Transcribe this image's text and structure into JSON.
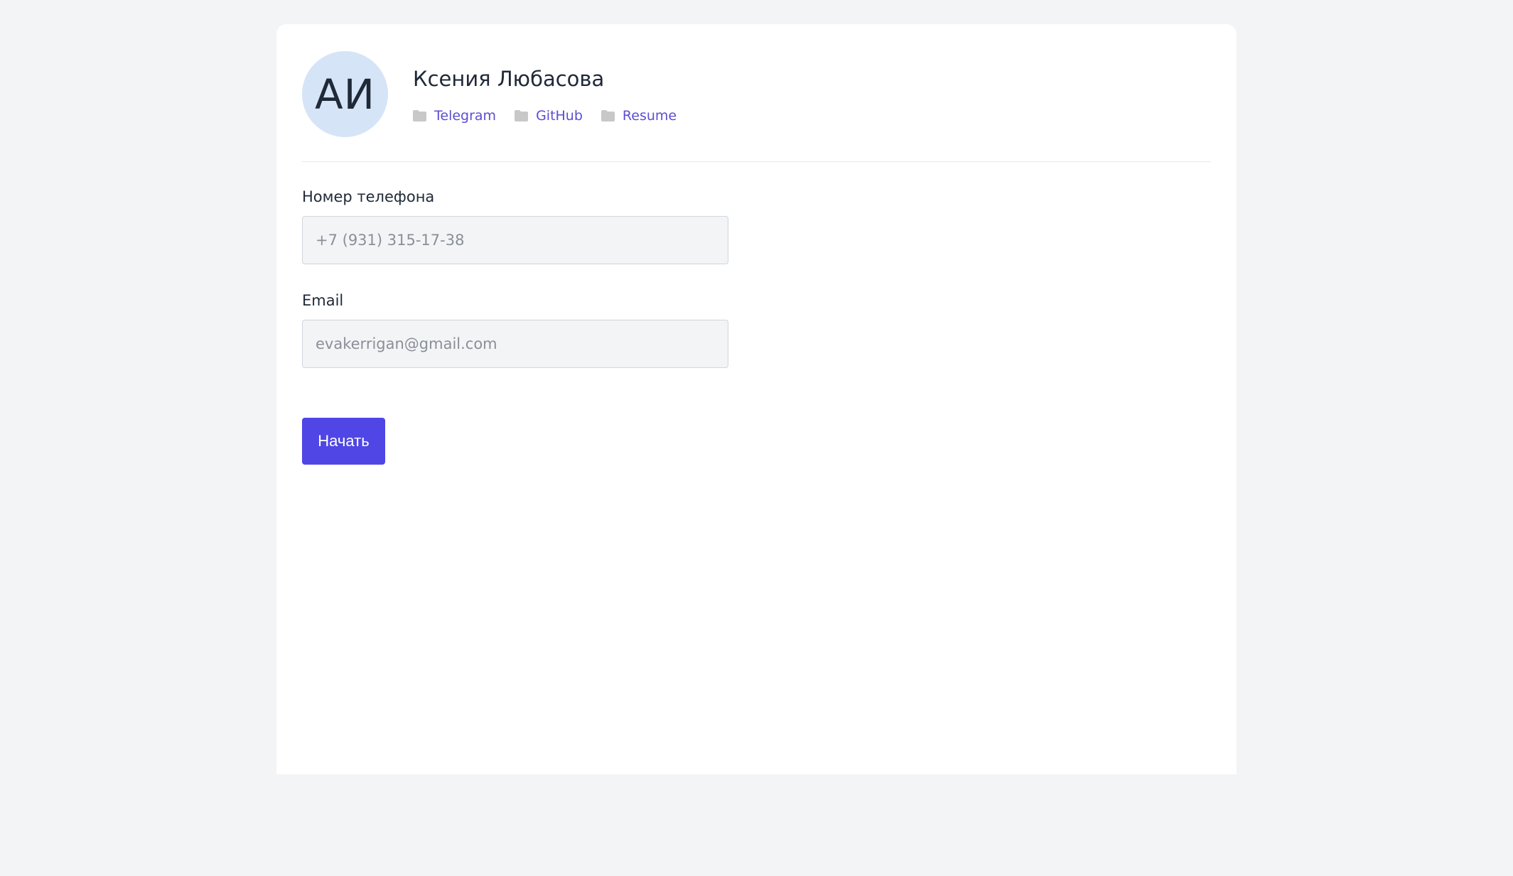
{
  "profile": {
    "initials": "АИ",
    "name": "Ксения Любасова",
    "links": [
      {
        "label": "Telegram",
        "icon": "folder-icon"
      },
      {
        "label": "GitHub",
        "icon": "folder-icon"
      },
      {
        "label": "Resume",
        "icon": "folder-icon"
      }
    ]
  },
  "form": {
    "phone": {
      "label": "Номер телефона",
      "placeholder": "+7 (931) 315-17-38",
      "value": ""
    },
    "email": {
      "label": "Email",
      "placeholder": "evakerrigan@gmail.com",
      "value": ""
    },
    "submit_label": "Начать"
  },
  "colors": {
    "page_background": "#f3f4f6",
    "card_background": "#ffffff",
    "avatar_background": "#d6e4f7",
    "link_color": "#5a4fcf",
    "button_color": "#4f46e5",
    "icon_color": "#c8c8c8"
  }
}
